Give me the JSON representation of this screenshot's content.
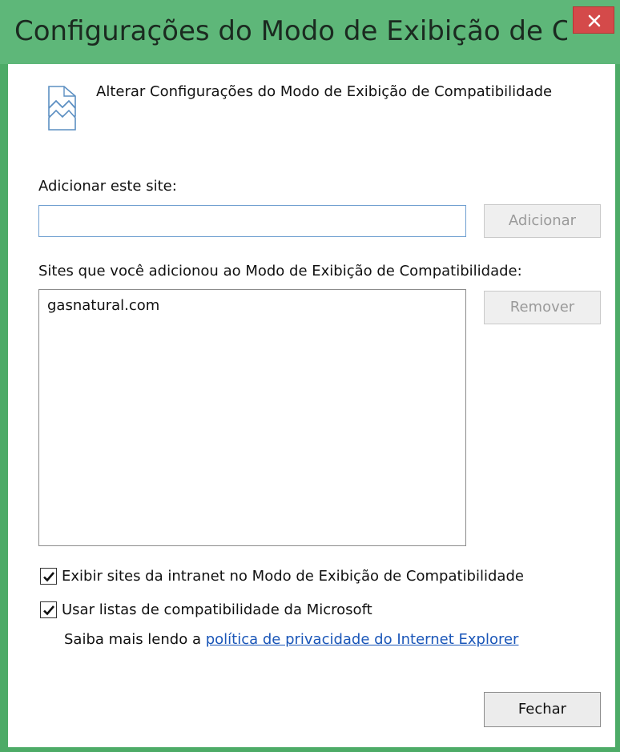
{
  "window": {
    "title": "Configurações do Modo de Exibição de Compatib...",
    "close_icon": "close-icon"
  },
  "header": {
    "icon": "compatibility-view-icon",
    "text": "Alterar Configurações do Modo de Exibição de Compatibilidade"
  },
  "add_site": {
    "label": "Adicionar este site:",
    "input_value": "",
    "button_label": "Adicionar"
  },
  "sites": {
    "label": "Sites que você adicionou ao Modo de Exibição de Compatibilidade:",
    "items": [
      "gasnatural.com"
    ],
    "remove_label": "Remover"
  },
  "options": {
    "intranet_label": "Exibir sites da intranet no Modo de Exibição de Compatibilidade",
    "intranet_checked": true,
    "microsoft_lists_label": "Usar listas de compatibilidade da Microsoft",
    "microsoft_lists_checked": true
  },
  "learn_more": {
    "prefix": "Saiba mais lendo a ",
    "link_text": "política de privacidade do Internet Explorer"
  },
  "footer": {
    "close_label": "Fechar"
  },
  "colors": {
    "titlebar": "#5eb779",
    "frame": "#4dab67",
    "close_button": "#d44a4a",
    "link": "#1a56b8"
  }
}
